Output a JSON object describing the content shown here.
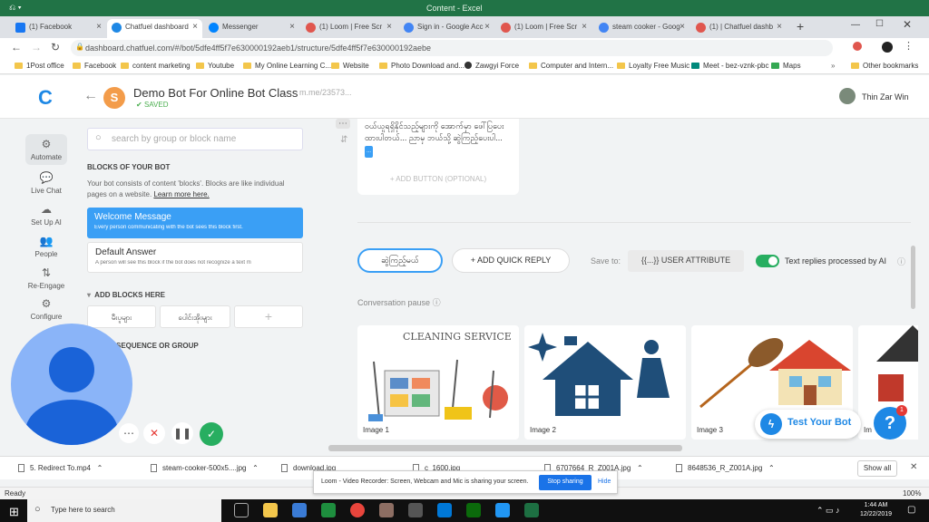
{
  "excel": {
    "title": "Content - Excel",
    "status": "Ready",
    "zoom": "100%"
  },
  "browser": {
    "tabs": [
      {
        "label": "(1) Facebook",
        "color": "#1877f2"
      },
      {
        "label": "Chatfuel dashboard",
        "color": "#1e88e5"
      },
      {
        "label": "Messenger",
        "color": "#0084ff"
      },
      {
        "label": "(1) Loom | Free Scr",
        "color": "#e0564e"
      },
      {
        "label": "Sign in - Google Acc",
        "color": "#4285f4"
      },
      {
        "label": "(1) Loom | Free Scr",
        "color": "#e0564e"
      },
      {
        "label": "steam cooker - Goog",
        "color": "#4285f4"
      },
      {
        "label": "(1) | Chatfuel dashb",
        "color": "#e0564e"
      }
    ],
    "url": "dashboard.chatfuel.com/#/bot/5dfe4ff5f7e630000192aeb1/structure/5dfe4ff5f7e630000192aebe",
    "bookmarks": [
      "1Post office",
      "Facebook",
      "content marketing",
      "Youtube",
      "My Online Learning C...",
      "Website",
      "Photo Download and...",
      "Zawgyi Force",
      "Computer and Intern...",
      "Loyalty Free Music",
      "Meet - bez-vznk-pbc",
      "Maps",
      "Other bookmarks"
    ]
  },
  "header": {
    "logo": "C",
    "avatar_letter": "S",
    "bot_name": "Demo Bot For Online Bot Class",
    "saved": "SAVED",
    "mme": "m.me/23573...",
    "user": "Thin Zar Win"
  },
  "nav": [
    "Automate",
    "Live Chat",
    "Set Up AI",
    "People",
    "Re-Engage",
    "Configure"
  ],
  "panel": {
    "search_placeholder": "search by group or block name",
    "blocks_header": "BLOCKS OF YOUR BOT",
    "desc": "Your bot consists of content 'blocks'. Blocks are like individual pages on a website.",
    "learn": "Learn more here.",
    "welcome": {
      "title": "Welcome Message",
      "sub": "Every person communicating with the bot sees this block first."
    },
    "default": {
      "title": "Default Answer",
      "sub": "A person will see this block if the bot does not recognize a text m"
    },
    "add_blocks": "ADD BLOCKS HERE",
    "chips": [
      "မီးပူများ",
      "ပေါင်းအိုးများ",
      "+"
    ],
    "seq": "SEQUENCE OR GROUP"
  },
  "main": {
    "card_text": "ဝယ်ယူရရှိနိုင်သည့်များကို အောက်မှာ ဖေါ်ပြပေးထားပါတယ်... ညာမှ ဘယ်သို့ ဆွဲကြည့်ပေးပါ...",
    "card_more": "...",
    "add_button": "+ ADD BUTTON (OPTIONAL)",
    "quick_reply_chip": "ဆွဲကြည့်မယ်",
    "add_quick_reply": "+ ADD QUICK REPLY",
    "save_to": "Save to:",
    "user_attribute": "{{...}}  USER ATTRIBUTE",
    "ai_label": "Text replies processed by AI",
    "conv_pause": "Conversation pause",
    "images": [
      {
        "caption": "Image 1",
        "heading": "CLEANING SERVICE"
      },
      {
        "caption": "Image 2"
      },
      {
        "caption": "Image 3"
      },
      {
        "caption": "Im"
      }
    ]
  },
  "floating": {
    "test_bot": "Test Your Bot",
    "help": "?",
    "help_badge": "1"
  },
  "downloads": {
    "files": [
      "5. Redirect To.mp4",
      "steam-cooker-500x5....jpg",
      "download.jpg",
      "c_1600.jpg",
      "6707664_R_Z001A.jpg",
      "8648536_R_Z001A.jpg"
    ],
    "show_all": "Show all"
  },
  "loom": {
    "text": "Loom - Video Recorder: Screen, Webcam and Mic is sharing your screen.",
    "stop": "Stop sharing",
    "hide": "Hide"
  },
  "taskbar": {
    "search": "Type here to search",
    "time": "1:44 AM",
    "date": "12/22/2019"
  },
  "colors": {
    "accent": "#1e88e5",
    "welcome": "#3a9ff5",
    "toggle": "#27ae60"
  }
}
